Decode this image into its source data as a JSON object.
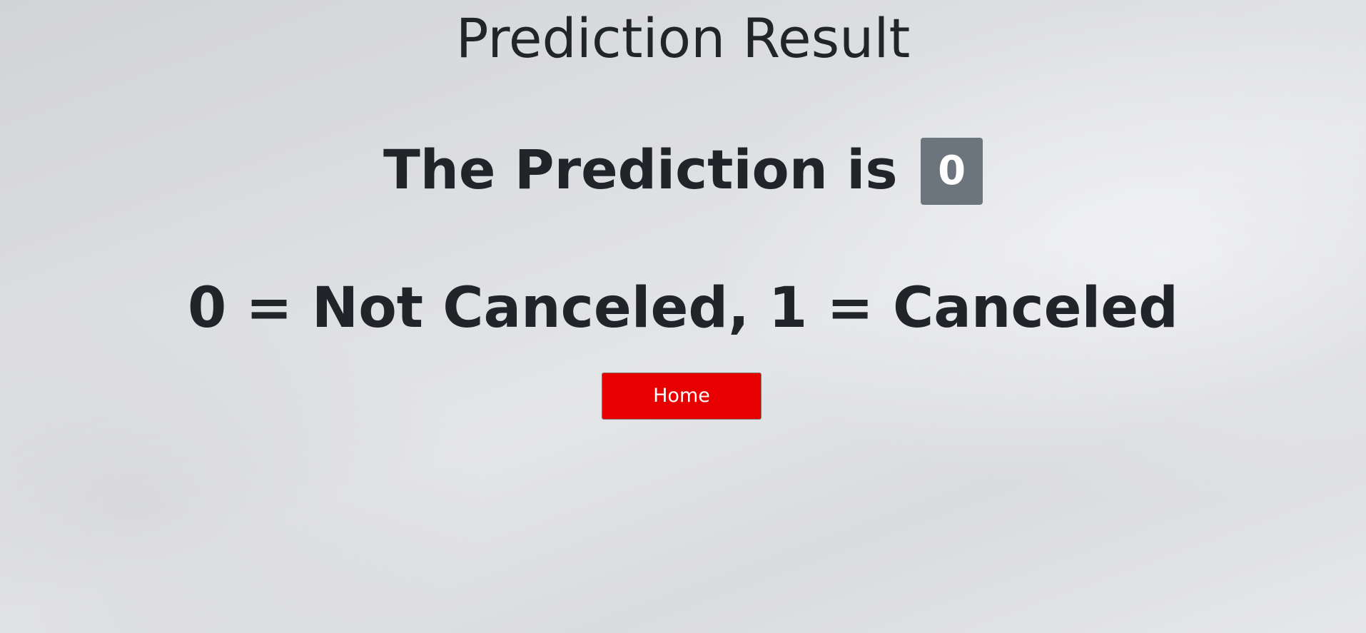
{
  "page": {
    "title": "Prediction Result"
  },
  "prediction": {
    "prefix": "The Prediction is",
    "value": "0",
    "badge_color": "#6c757d"
  },
  "legend": {
    "text": "0 = Not Canceled, 1 = Canceled"
  },
  "home_button": {
    "label": "Home",
    "color": "#e80000"
  }
}
